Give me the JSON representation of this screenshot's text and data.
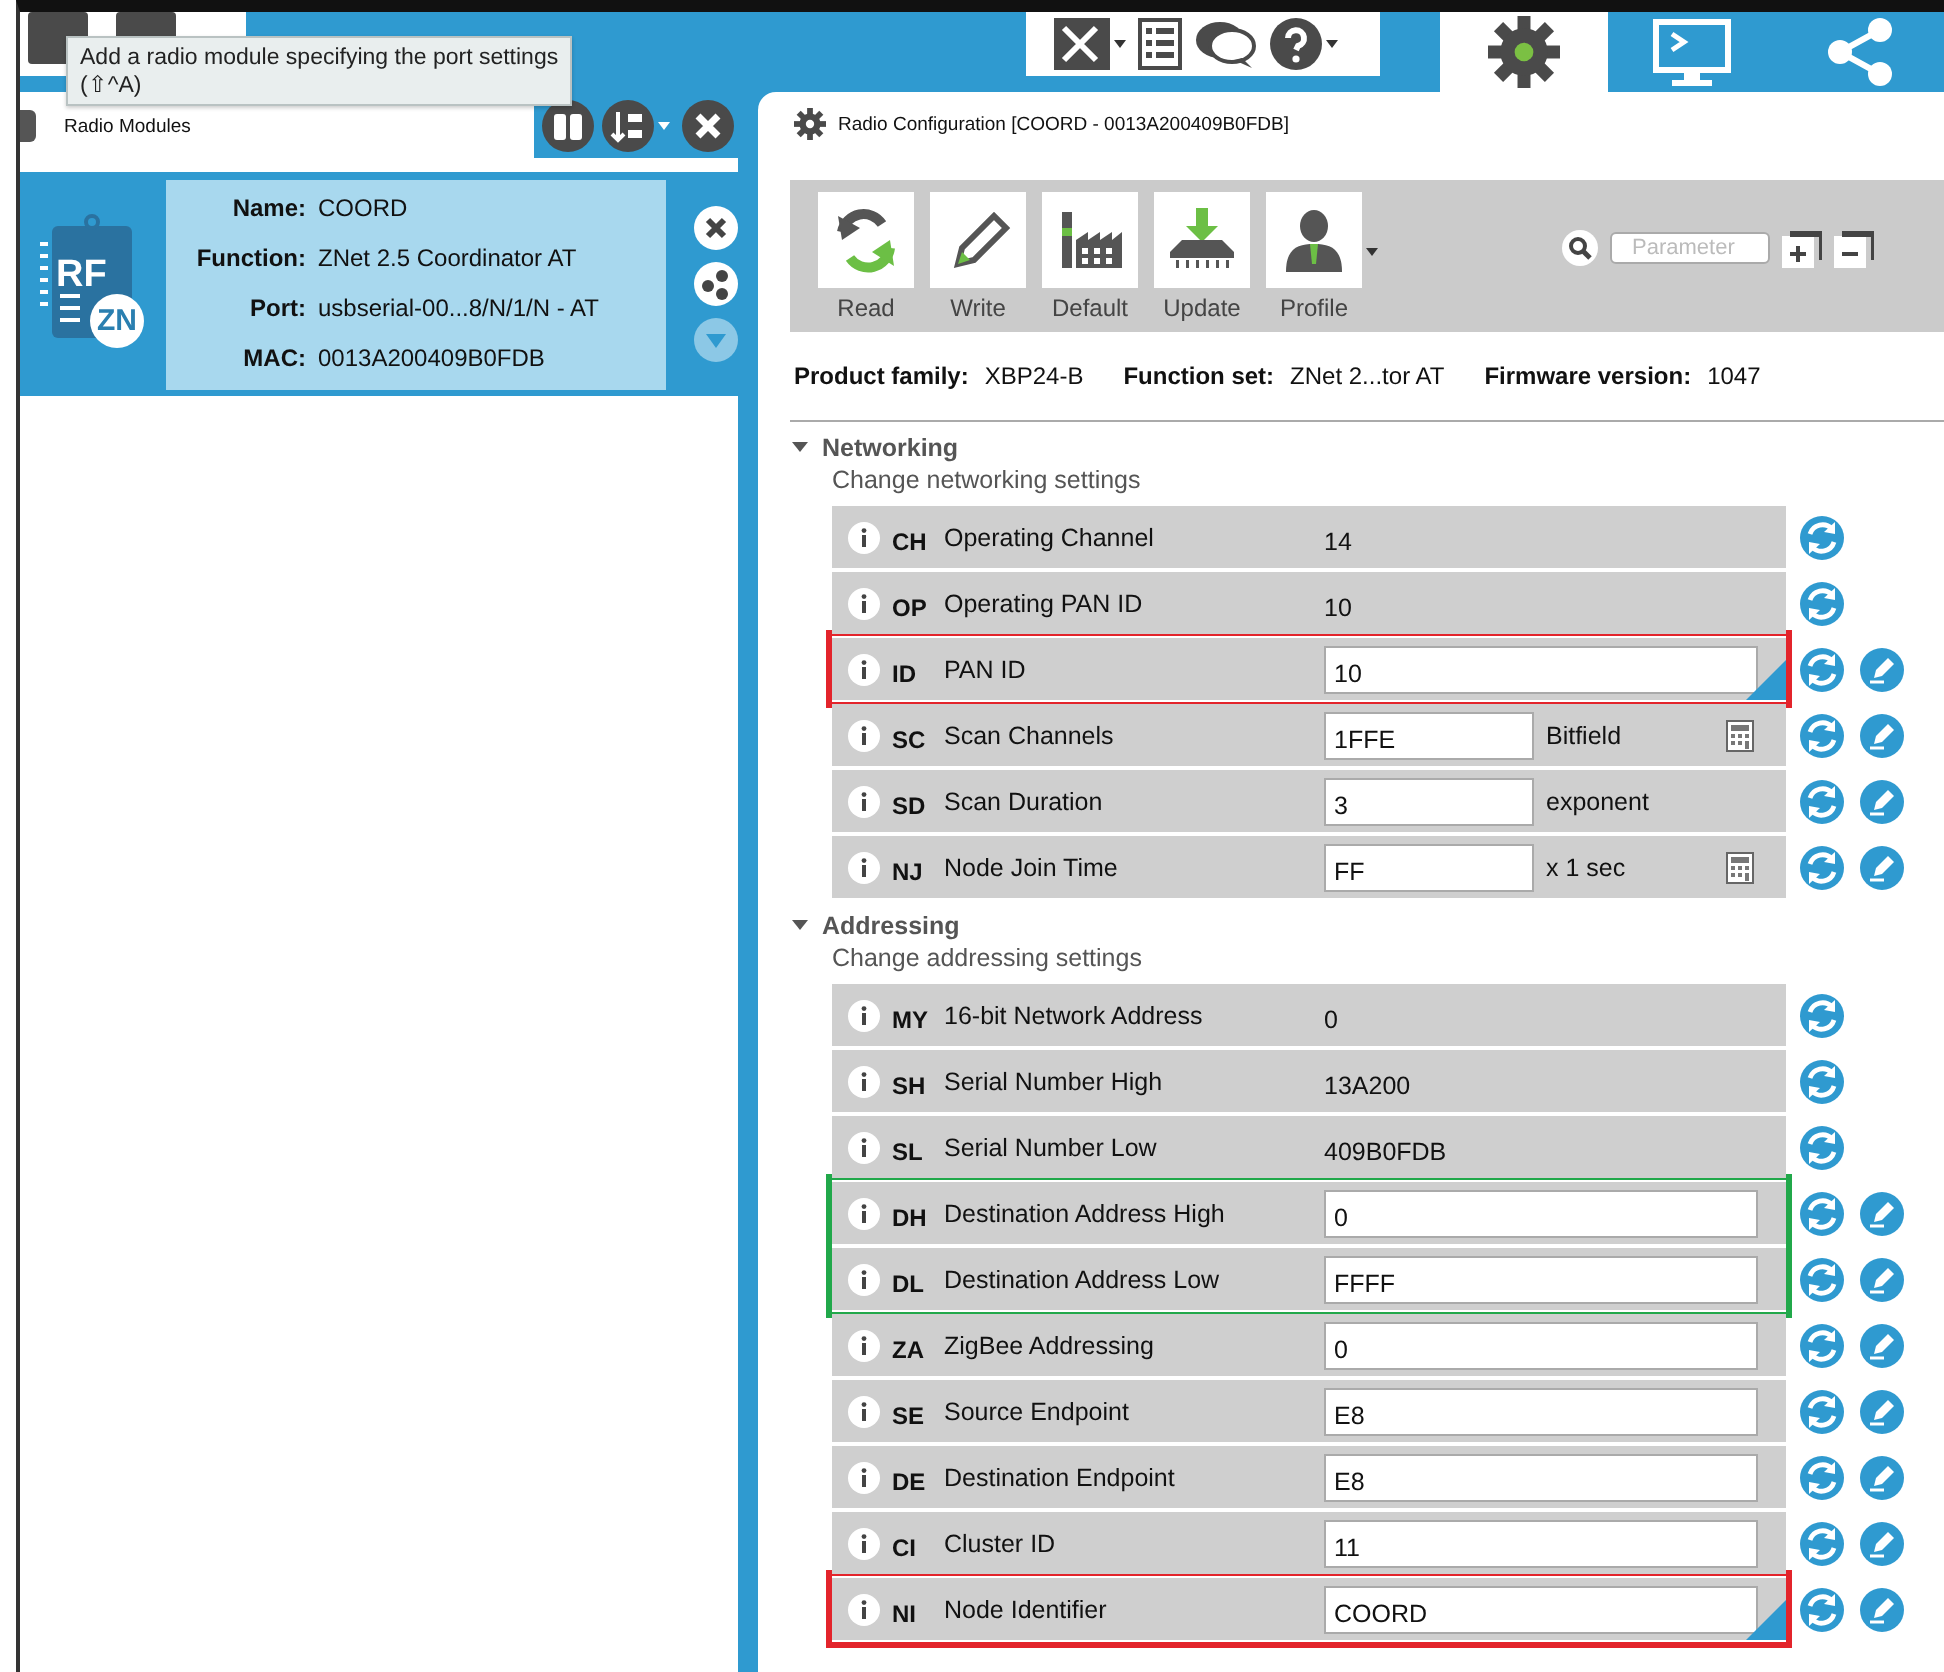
{
  "top_bar": {
    "tools": [
      {
        "kind": "tools",
        "menu": true
      },
      {
        "kind": "list",
        "menu": false
      },
      {
        "kind": "chat",
        "menu": false
      },
      {
        "kind": "help",
        "menu": true
      }
    ],
    "mode_tabs": [
      {
        "kind": "configuration",
        "selected": true
      },
      {
        "kind": "console",
        "selected": false
      },
      {
        "kind": "network",
        "selected": false
      }
    ]
  },
  "tooltip": {
    "lines": [
      "Add a radio module specifying the port settings",
      "(⇧^A)"
    ]
  },
  "radio_modules": {
    "title": "Radio Modules",
    "modules": [
      {
        "selected": true,
        "chip_text": "RF",
        "badge": "ZN",
        "fields": [
          {
            "label": "Name:",
            "value": "COORD"
          },
          {
            "label": "Function:",
            "value": "ZNet 2.5 Coordinator AT"
          },
          {
            "label": "Port:",
            "value": "usbserial-00...8/N/1/N - AT"
          },
          {
            "label": "MAC:",
            "value": "0013A200409B0FDB"
          }
        ],
        "actions": [
          {
            "kind": "remove",
            "disabled": false
          },
          {
            "kind": "network",
            "disabled": false
          },
          {
            "kind": "expand",
            "disabled": true
          }
        ]
      }
    ]
  },
  "configuration": {
    "title": "Radio Configuration [COORD - 0013A200409B0FDB]",
    "toolbar": [
      {
        "kind": "read",
        "label": "Read",
        "menu": false
      },
      {
        "kind": "write",
        "label": "Write",
        "menu": false
      },
      {
        "kind": "default",
        "label": "Default",
        "menu": false
      },
      {
        "kind": "update",
        "label": "Update",
        "menu": false
      },
      {
        "kind": "profile",
        "label": "Profile",
        "menu": true
      }
    ],
    "search": {
      "placeholder": "Parameter"
    },
    "info": [
      {
        "label": "Product family:",
        "value": "XBP24-B"
      },
      {
        "label": "Function set:",
        "value": "ZNet 2...tor AT"
      },
      {
        "label": "Firmware version:",
        "value": "1047"
      }
    ],
    "sections": [
      {
        "title": "Networking",
        "subtitle": "Change networking settings",
        "expanded": true,
        "rows": [
          {
            "kind": "readonly",
            "code": "CH",
            "name": "Operating Channel",
            "value": "14"
          },
          {
            "kind": "readonly",
            "code": "OP",
            "name": "Operating PAN ID",
            "value": "10"
          },
          {
            "kind": "editable",
            "code": "ID",
            "name": "PAN ID",
            "value": "10",
            "non_default": true,
            "color": "#e3242b"
          },
          {
            "kind": "editable",
            "code": "SC",
            "name": "Scan Channels",
            "value": "1FFE",
            "unit": "Bitfield",
            "calculator": true,
            "non_default": false
          },
          {
            "kind": "editable",
            "code": "SD",
            "name": "Scan Duration",
            "value": "3",
            "unit": "exponent",
            "calculator": false,
            "non_default": false
          },
          {
            "kind": "editable",
            "code": "NJ",
            "name": "Node Join Time",
            "value": "FF",
            "unit": "x 1 sec",
            "calculator": true,
            "non_default": false
          }
        ]
      },
      {
        "title": "Addressing",
        "subtitle": "Change addressing settings",
        "expanded": true,
        "rows": [
          {
            "kind": "readonly",
            "code": "MY",
            "name": "16-bit Network Address",
            "value": "0"
          },
          {
            "kind": "readonly",
            "code": "SH",
            "name": "Serial Number High",
            "value": "13A200"
          },
          {
            "kind": "readonly",
            "code": "SL",
            "name": "Serial Number Low",
            "value": "409B0FDB"
          },
          {
            "kind": "editable",
            "code": "DH",
            "name": "Destination Address High",
            "value": "0",
            "non_default": false,
            "color": "#21a84a"
          },
          {
            "kind": "editable",
            "code": "DL",
            "name": "Destination Address Low",
            "value": "FFFF",
            "non_default": false,
            "color": "#21a84a"
          },
          {
            "kind": "editable",
            "code": "ZA",
            "name": "ZigBee Addressing",
            "value": "0",
            "non_default": false
          },
          {
            "kind": "editable",
            "code": "SE",
            "name": "Source Endpoint",
            "value": "E8",
            "non_default": false
          },
          {
            "kind": "editable",
            "code": "DE",
            "name": "Destination Endpoint",
            "value": "E8",
            "non_default": false
          },
          {
            "kind": "editable",
            "code": "CI",
            "name": "Cluster ID",
            "value": "11",
            "non_default": false
          },
          {
            "kind": "editable",
            "code": "NI",
            "name": "Node Identifier",
            "value": "COORD",
            "non_default": true,
            "color": "#e3242b"
          }
        ]
      }
    ]
  }
}
